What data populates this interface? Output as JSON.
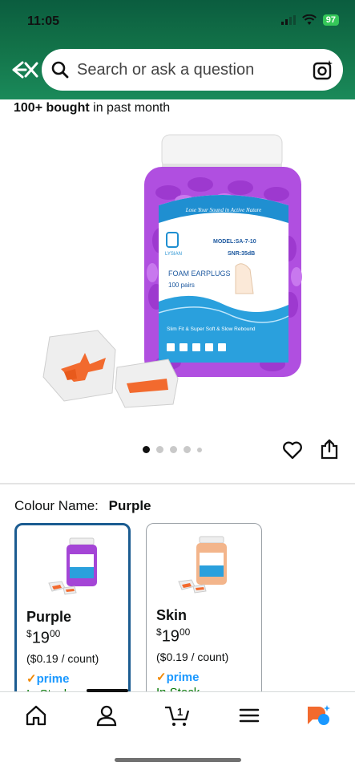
{
  "status": {
    "time": "11:05",
    "battery": "97"
  },
  "search": {
    "placeholder": "Search or ask a question"
  },
  "product": {
    "bought_bold": "100+ bought",
    "bought_rest": "in past month",
    "jar": {
      "brand_arc": "Lose Your Sound in Active Nature",
      "brand": "LYSIAN",
      "model": "MODEL:SA-7-10",
      "snr": "SNR:35dB",
      "title": "FOAM EARPLUGS",
      "count": "100 pairs",
      "tagline": "Slim Fit & Super Soft & Slow Rebound"
    }
  },
  "colour": {
    "label": "Colour Name:",
    "selected": "Purple",
    "options": [
      {
        "name": "Purple",
        "currency": "$",
        "dollars": "19",
        "cents": "00",
        "unit": "($0.19 / count)",
        "prime": "prime",
        "stock": "In Stock",
        "accent": "#a445d6"
      },
      {
        "name": "Skin",
        "currency": "$",
        "dollars": "19",
        "cents": "00",
        "unit": "($0.19 / count)",
        "prime": "prime",
        "stock": "In Stock",
        "accent": "#f3b58b"
      }
    ]
  },
  "colors": {
    "selected_border": "#1b5c91",
    "prime_blue": "#1a98ff",
    "header_green": "#127148",
    "earplug_orange": "#f26a2e"
  }
}
